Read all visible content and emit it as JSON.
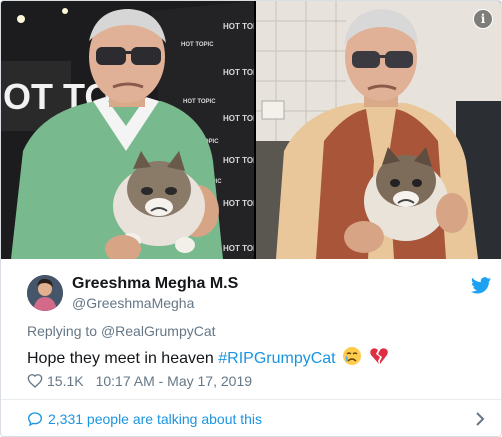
{
  "media": {
    "left_photo": {
      "signage_text": "HOT TOPIC",
      "signage_big": "OT TO"
    },
    "right_photo": {},
    "info_label": "i"
  },
  "author": {
    "display_name": "Greeshma Megha M.S",
    "handle": "@GreeshmaMegha",
    "avatar_icon": "user-avatar"
  },
  "reply": {
    "prefix": "Replying to",
    "mention": "@RealGrumpyCat"
  },
  "tweet": {
    "text": "Hope they meet in heaven",
    "hashtag": "#RIPGrumpyCat",
    "emojis": [
      "crying-face-icon",
      "broken-heart-icon"
    ]
  },
  "meta": {
    "likes": "15.1K",
    "timestamp": "10:17 AM - May 17, 2019"
  },
  "footer": {
    "talking": "2,331 people are talking about this"
  },
  "colors": {
    "link": "#1b95e0",
    "muted": "#657786",
    "heart": "#e0245e",
    "twitter_blue": "#1da1f2"
  }
}
